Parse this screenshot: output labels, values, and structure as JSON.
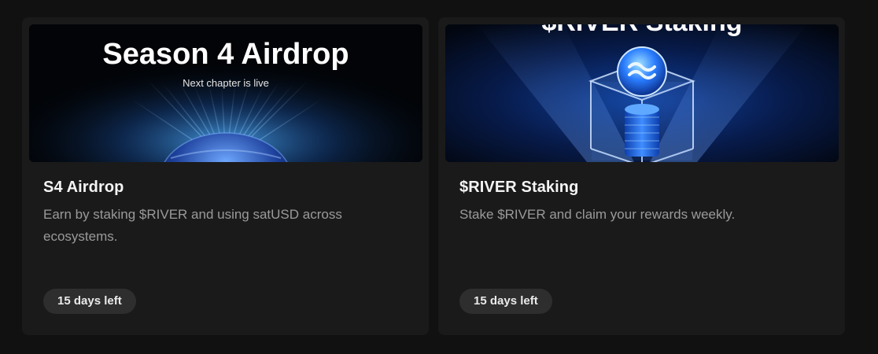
{
  "cards": [
    {
      "banner": {
        "headline": "Season 4 Airdrop",
        "subline": "Next chapter is live"
      },
      "title": "S4 Airdrop",
      "description": "Earn by staking $RIVER and using satUSD across ecosystems.",
      "badge": "15 days left"
    },
    {
      "banner": {
        "headline": "$RIVER Staking",
        "icon": "river-coin-icon"
      },
      "title": "$RIVER Staking",
      "description": "Stake $RIVER and claim your rewards weekly.",
      "badge": "15 days left"
    }
  ],
  "colors": {
    "page_background": "#111111",
    "card_background": "#1a1a1a",
    "badge_background": "#2e2e2e",
    "title_text": "#f4f4f4",
    "description_text": "#9a9a9a",
    "accent_blue": "#2a7dff"
  }
}
